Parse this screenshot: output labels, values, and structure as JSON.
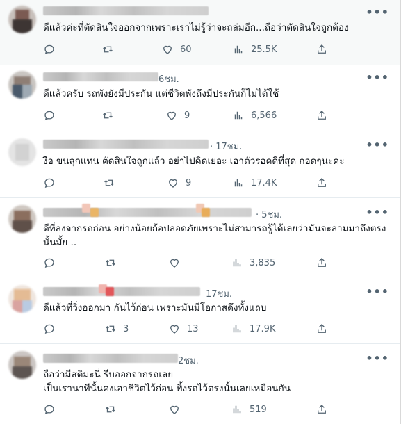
{
  "icons": {
    "reply": "reply-icon",
    "retweet": "retweet-icon",
    "like": "like-icon",
    "views": "views-icon",
    "share": "share-icon",
    "more": "more-icon"
  },
  "colors": {
    "icon": "#536471",
    "text": "#0f1419",
    "highlight_row": "#f7f9f9"
  },
  "more_glyph": "•••",
  "posts": [
    {
      "time": "",
      "text": [
        "ดีแล้วค่ะที่ตัดสินใจออกจากเพราะเราไม่รู้ว่าจะถล่มอีก...ถือว่าตัดสินใจถูกต้อง"
      ],
      "reply_count": "",
      "retweet_count": "",
      "like_count": "60",
      "view_count": "25.5K"
    },
    {
      "time": "6ชม.",
      "text": [
        "ดีแล้วครับ รถพังยังมีประกัน แต่ชีวิตพังถึงมีประกันก็ไม่ได้ใช้"
      ],
      "reply_count": "",
      "retweet_count": "",
      "like_count": "9",
      "view_count": "6,566"
    },
    {
      "time": "· 17ชม.",
      "text": [
        "งือ ขนลุกแทน ตัดสินใจถูกแล้ว อย่าไปคิดเยอะ เอาตัวรอดดีที่สุด กอดๆนะคะ"
      ],
      "reply_count": "",
      "retweet_count": "",
      "like_count": "9",
      "view_count": "17.4K"
    },
    {
      "time": "· 5ชม.",
      "text": [
        "ดีที่ลงจากรถก่อน อย่างน้อยก้อปลอดภัยเพราะไม่สามารถรู้ได้เลยว่ามันจะลามมาถึงตรง",
        "นั้นมั้ย .."
      ],
      "reply_count": "",
      "retweet_count": "",
      "like_count": "",
      "view_count": "3,835"
    },
    {
      "time": "17ชม.",
      "text": [
        "ดีแล้วที่วิ่งออกมา กันไว้ก่อน เพราะมันมีโอกาสดึงทั้งแถบ"
      ],
      "reply_count": "",
      "retweet_count": "3",
      "like_count": "13",
      "view_count": "17.9K"
    },
    {
      "time": "2ชม.",
      "text": [
        "ถือว่ามีสติมะนี่ รีบออกจากรถเลย",
        "เป็นเรานาทีนั้นคงเอาชีวิตไว้ก่อน ทิ้งรถไว้ตรงนั้นเลยเหมือนกัน"
      ],
      "reply_count": "",
      "retweet_count": "",
      "like_count": "",
      "view_count": "519"
    }
  ]
}
